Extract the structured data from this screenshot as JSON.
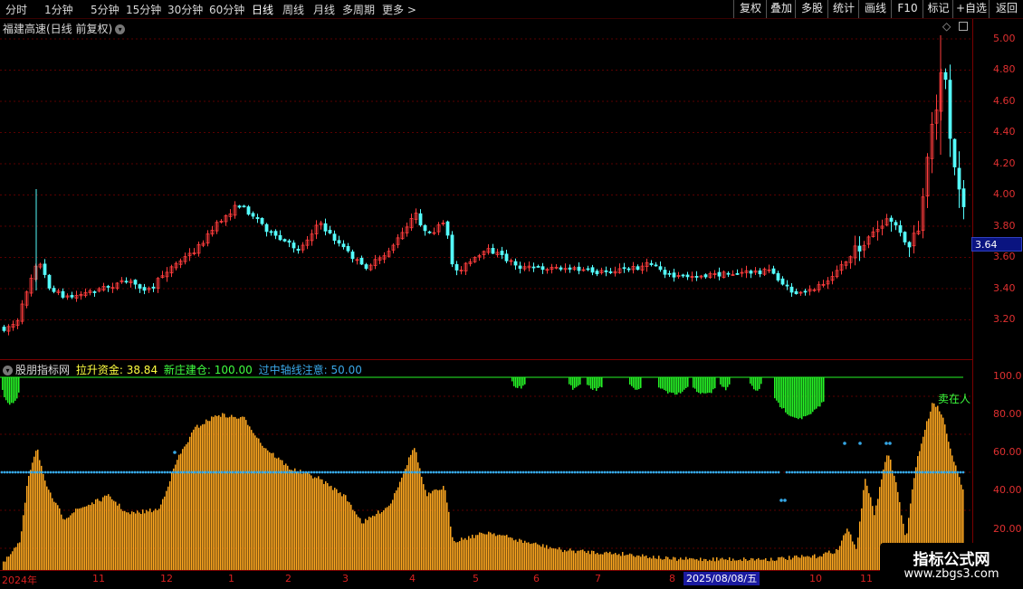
{
  "toolbar": {
    "periods": [
      "分时",
      "1分钟",
      "5分钟",
      "15分钟",
      "30分钟",
      "60分钟",
      "日线",
      "周线",
      "月线",
      "多周期",
      "更多 >"
    ],
    "active_period": "日线",
    "right_buttons": [
      "复权",
      "叠加",
      "多股",
      "统计",
      "画线",
      "F10",
      "标记",
      "+自选",
      "返回"
    ]
  },
  "main_chart": {
    "title": "福建高速(日线 前复权)",
    "price_axis": [
      "5.00",
      "4.80",
      "4.60",
      "4.40",
      "4.20",
      "4.00",
      "3.80",
      "3.60",
      "3.40",
      "3.20"
    ],
    "current_price": "3.64",
    "colors": {
      "up": "#ff3c3c",
      "down": "#54fcfc",
      "grid": "#5a0000",
      "axis": "#e03030"
    }
  },
  "indicator": {
    "name": "股朋指标网",
    "line1": {
      "label": "拉升资金",
      "value": "38.84",
      "color": "#ffff40"
    },
    "line2": {
      "label": "新庄建仓",
      "value": "100.00",
      "color": "#40ff40"
    },
    "line3": {
      "label": "过中轴线注意",
      "value": "50.00",
      "color": "#3aa8e8"
    },
    "axis": [
      "100.0",
      "80.00",
      "60.00",
      "40.00",
      "20.00"
    ],
    "signal_text": "卖在人",
    "colors": {
      "bar": "#ffa820",
      "green": "#26f526",
      "dots": "#35a8e6"
    }
  },
  "time_axis": {
    "labels": [
      "2024年",
      "11",
      "12",
      "1",
      "2",
      "3",
      "4",
      "5",
      "6",
      "7",
      "8",
      "10",
      "11"
    ],
    "cursor_date": "2025/08/08/五"
  },
  "watermark": {
    "title": "指标公式网",
    "url": "www.zbgs3.com"
  }
}
